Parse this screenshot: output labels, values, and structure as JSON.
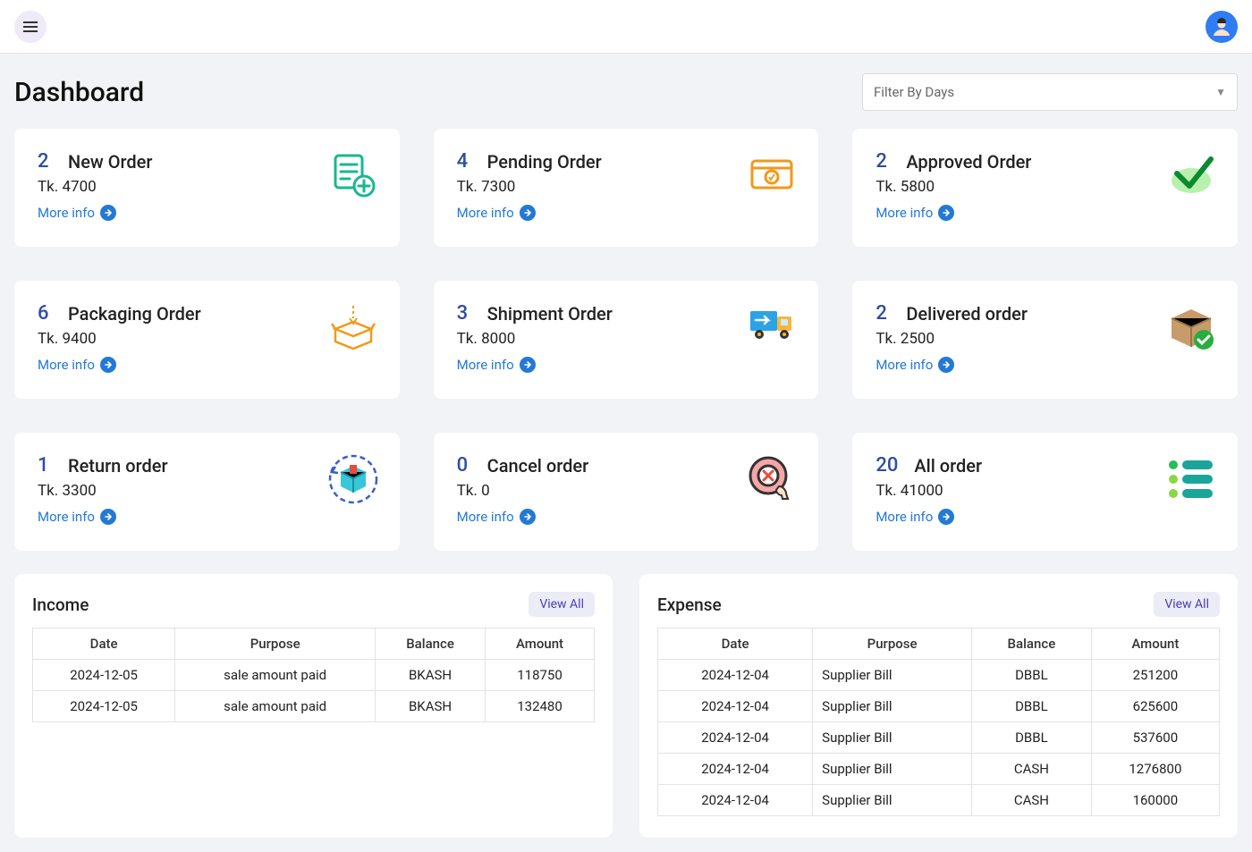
{
  "header": {
    "title": "Dashboard",
    "filter_placeholder": "Filter By Days"
  },
  "cards": [
    {
      "count": "2",
      "label": "New Order",
      "amount_prefix": "Tk. ",
      "amount": "4700",
      "more": "More info",
      "icon": "list-plus"
    },
    {
      "count": "4",
      "label": "Pending Order",
      "amount_prefix": "Tk. ",
      "amount": "7300",
      "more": "More info",
      "icon": "money"
    },
    {
      "count": "2",
      "label": "Approved Order",
      "amount_prefix": "Tk. ",
      "amount": "5800",
      "more": "More info",
      "icon": "check"
    },
    {
      "count": "6",
      "label": "Packaging Order",
      "amount_prefix": "Tk. ",
      "amount": "9400",
      "more": "More info",
      "icon": "open-box"
    },
    {
      "count": "3",
      "label": "Shipment Order",
      "amount_prefix": "Tk. ",
      "amount": "8000",
      "more": "More info",
      "icon": "truck"
    },
    {
      "count": "2",
      "label": "Delivered order",
      "amount_prefix": "Tk. ",
      "amount": "2500",
      "more": "More info",
      "icon": "box-ok"
    },
    {
      "count": "1",
      "label": "Return order",
      "amount_prefix": "Tk. ",
      "amount": "3300",
      "more": "More info",
      "icon": "return-box"
    },
    {
      "count": "0",
      "label": "Cancel order",
      "amount_prefix": "Tk. ",
      "amount": "0",
      "more": "More info",
      "icon": "cancel"
    },
    {
      "count": "20",
      "label": "All order",
      "amount_prefix": "Tk. ",
      "amount": "41000",
      "more": "More info",
      "icon": "list-dots"
    }
  ],
  "income": {
    "title": "Income",
    "view_all": "View All",
    "columns": [
      "Date",
      "Purpose",
      "Balance",
      "Amount"
    ],
    "rows": [
      [
        "2024-12-05",
        "sale amount paid",
        "BKASH",
        "118750"
      ],
      [
        "2024-12-05",
        "sale amount paid",
        "BKASH",
        "132480"
      ]
    ]
  },
  "expense": {
    "title": "Expense",
    "view_all": "View All",
    "columns": [
      "Date",
      "Purpose",
      "Balance",
      "Amount"
    ],
    "rows": [
      [
        "2024-12-04",
        "Supplier Bill",
        "DBBL",
        "251200"
      ],
      [
        "2024-12-04",
        "Supplier Bill",
        "DBBL",
        "625600"
      ],
      [
        "2024-12-04",
        "Supplier Bill",
        "DBBL",
        "537600"
      ],
      [
        "2024-12-04",
        "Supplier Bill",
        "CASH",
        "1276800"
      ],
      [
        "2024-12-04",
        "Supplier Bill",
        "CASH",
        "160000"
      ]
    ]
  }
}
